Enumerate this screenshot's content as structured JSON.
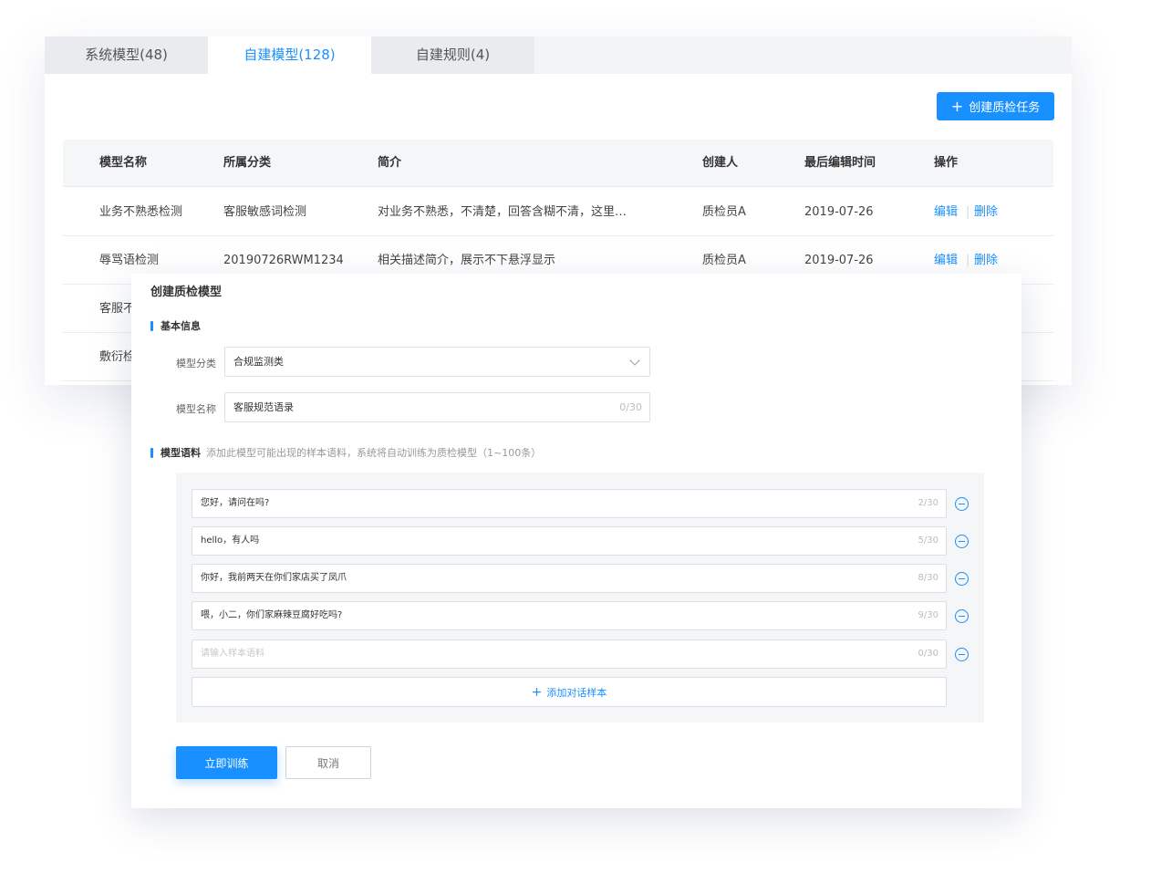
{
  "tabs": [
    {
      "label": "系统模型(48)"
    },
    {
      "label": "自建模型(128)"
    },
    {
      "label": "自建规则(4)"
    }
  ],
  "create_task_button": {
    "icon": "+",
    "label": "创建质检任务"
  },
  "table": {
    "headers": [
      "模型名称",
      "所属分类",
      "简介",
      "创建人",
      "最后编辑时间",
      "操作"
    ],
    "rows": [
      {
        "name": "业务不熟悉检测",
        "category": "客服敏感词检测",
        "intro": "对业务不熟悉，不清楚，回答含糊不清，这里…",
        "creator": "质检员A",
        "time": "2019-07-26",
        "edit": "编辑",
        "delete": "删除"
      },
      {
        "name": "辱骂语检测",
        "category": "20190726RWM1234",
        "intro": "相关描述简介，展示不下悬浮显示",
        "creator": "质检员A",
        "time": "2019-07-26",
        "edit": "编辑",
        "delete": "删除"
      },
      {
        "name": "客服不"
      },
      {
        "name": "敷衍检"
      }
    ]
  },
  "modal": {
    "title": "创建质检模型",
    "basic_section": "基本信息",
    "category_label": "模型分类",
    "category_value": "合规监测类",
    "name_label": "模型名称",
    "name_value": "客服规范语录",
    "name_counter": "0/30",
    "corpus_section": "模型语料",
    "corpus_hint": "添加此模型可能出现的样本语料，系统将自动训练为质检模型（1~100条）",
    "samples": [
      {
        "text": "您好，请问在吗?",
        "counter": "2/30"
      },
      {
        "text": "hello，有人吗",
        "counter": "5/30"
      },
      {
        "text": "你好，我前两天在你们家店买了凤爪",
        "counter": "8/30"
      },
      {
        "text": "喂，小二，你们家麻辣豆腐好吃吗?",
        "counter": "9/30"
      }
    ],
    "empty_sample": {
      "placeholder": "请输入样本语料",
      "counter": "0/30"
    },
    "add_sample": {
      "icon": "+",
      "label": "添加对话样本"
    },
    "train_button": "立即训练",
    "cancel_button": "取消"
  },
  "colors": {
    "accent": "#1890ff"
  }
}
